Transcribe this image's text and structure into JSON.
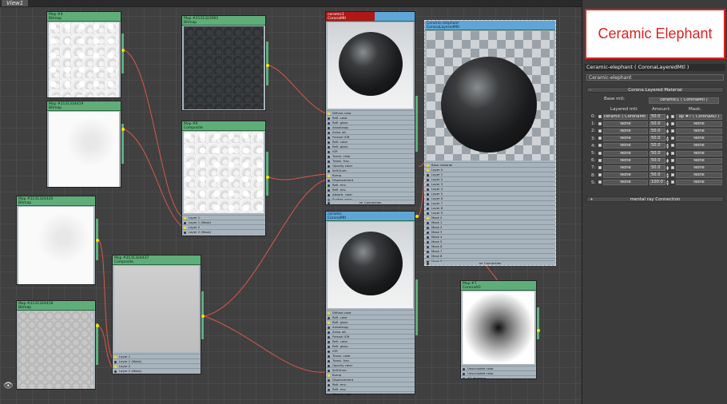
{
  "view_tab": "View1",
  "nodes": {
    "map4": {
      "title": "Map #4",
      "type": "Bitmap"
    },
    "map_a": {
      "title": "Map #2131324419",
      "type": "Bitmap"
    },
    "map_b": {
      "title": "Map #2131324420",
      "type": "Bitmap"
    },
    "map_c": {
      "title": "Map #2131324418",
      "type": "Bitmap"
    },
    "map_dark": {
      "title": "Map #2131323961",
      "type": "Bitmap"
    },
    "map6": {
      "title": "Map #6",
      "type": "Composite",
      "slots": [
        "Layer 1",
        "Layer 1 (Mask)",
        "Layer 2",
        "Layer 2 (Mask)"
      ]
    },
    "map_comp2": {
      "title": "Map #2131324437",
      "type": "Composite",
      "slots": [
        "Layer 1",
        "Layer 1 (Mask)",
        "Layer 2",
        "Layer 2 (Mask)"
      ]
    },
    "ceramic1": {
      "title": "ceramic1",
      "type": "CoronaMtl",
      "slots": [
        "Diffuse color",
        "Refl. color",
        "Refl. gloss",
        "Anisotropy",
        "Aniso rot.",
        "Fresnel IOR",
        "Refr. color",
        "Refr. gloss",
        "IOR",
        "Transl. color",
        "Transl. frac.",
        "Opacity color",
        "Self-illum.",
        "Bump",
        "Displacement",
        "Refr. env.",
        "Refl. env.",
        "Absorb. color",
        "Scatter color"
      ],
      "footer": "mr Connection"
    },
    "ceramic": {
      "title": "ceramic",
      "type": "CoronaMtl",
      "slots": [
        "Diffuse color",
        "Refl. color",
        "Refl. gloss",
        "Anisotropy",
        "Aniso rot.",
        "Fresnel IOR",
        "Refr. color",
        "Refr. gloss",
        "IOR",
        "Transl. color",
        "Transl. frac.",
        "Opacity color",
        "Self-illum.",
        "Bump",
        "Displacement",
        "Refr. env.",
        "Refl. env.",
        "Absorb. color"
      ]
    },
    "elephant": {
      "title": "Ceramic-elephant",
      "type": "CoronaLayeredMtl",
      "slots": [
        "Base material",
        "Layer 0",
        "Layer 1",
        "Layer 2",
        "Layer 3",
        "Layer 4",
        "Layer 5",
        "Layer 6",
        "Layer 7",
        "Layer 8",
        "Layer 9",
        "Mask 0",
        "Mask 1",
        "Mask 2",
        "Mask 3",
        "Mask 4",
        "Mask 5",
        "Mask 6",
        "Mask 7",
        "Mask 8",
        "Mask 9"
      ],
      "footer": "mr Connection"
    },
    "map7": {
      "title": "Map #7",
      "type": "CoronaAO",
      "slots": [
        "Unoccluded color",
        "Unoccluded color",
        "AO distance"
      ]
    }
  },
  "panel": {
    "preview_label": "Ceramic Elephant",
    "title": "Ceramic-elephant  ( CoronaLayeredMtl )",
    "material_name": "Ceramic-elephant",
    "rollout_title": "Corona Layered Material",
    "base_label": "Base mtl:",
    "base_value": "ceramic1  ( CoronaMtl )",
    "col_layered": "Layered mtl:",
    "col_amount": "Amount:",
    "col_mask": "Mask:",
    "rows": [
      {
        "idx": "0:",
        "mtl": "ceramic  ( CoronaMtl )",
        "amount": "50.0",
        "mask": "ap #7  ( CoronaAO )"
      },
      {
        "idx": "1:",
        "mtl": "None",
        "amount": "50.0",
        "mask": "None"
      },
      {
        "idx": "2:",
        "mtl": "None",
        "amount": "50.0",
        "mask": "None"
      },
      {
        "idx": "3:",
        "mtl": "None",
        "amount": "50.0",
        "mask": "None"
      },
      {
        "idx": "4:",
        "mtl": "None",
        "amount": "50.0",
        "mask": "None"
      },
      {
        "idx": "5:",
        "mtl": "None",
        "amount": "50.0",
        "mask": "None"
      },
      {
        "idx": "6:",
        "mtl": "None",
        "amount": "50.0",
        "mask": "None"
      },
      {
        "idx": "7:",
        "mtl": "None",
        "amount": "50.0",
        "mask": "None"
      },
      {
        "idx": "8:",
        "mtl": "None",
        "amount": "50.0",
        "mask": "None"
      },
      {
        "idx": "S:",
        "mtl": "None",
        "amount": "100.0",
        "mask": "None"
      }
    ],
    "mr_rollout": "mental ray Connection",
    "minus_sign": "-",
    "plus_sign": "+"
  }
}
